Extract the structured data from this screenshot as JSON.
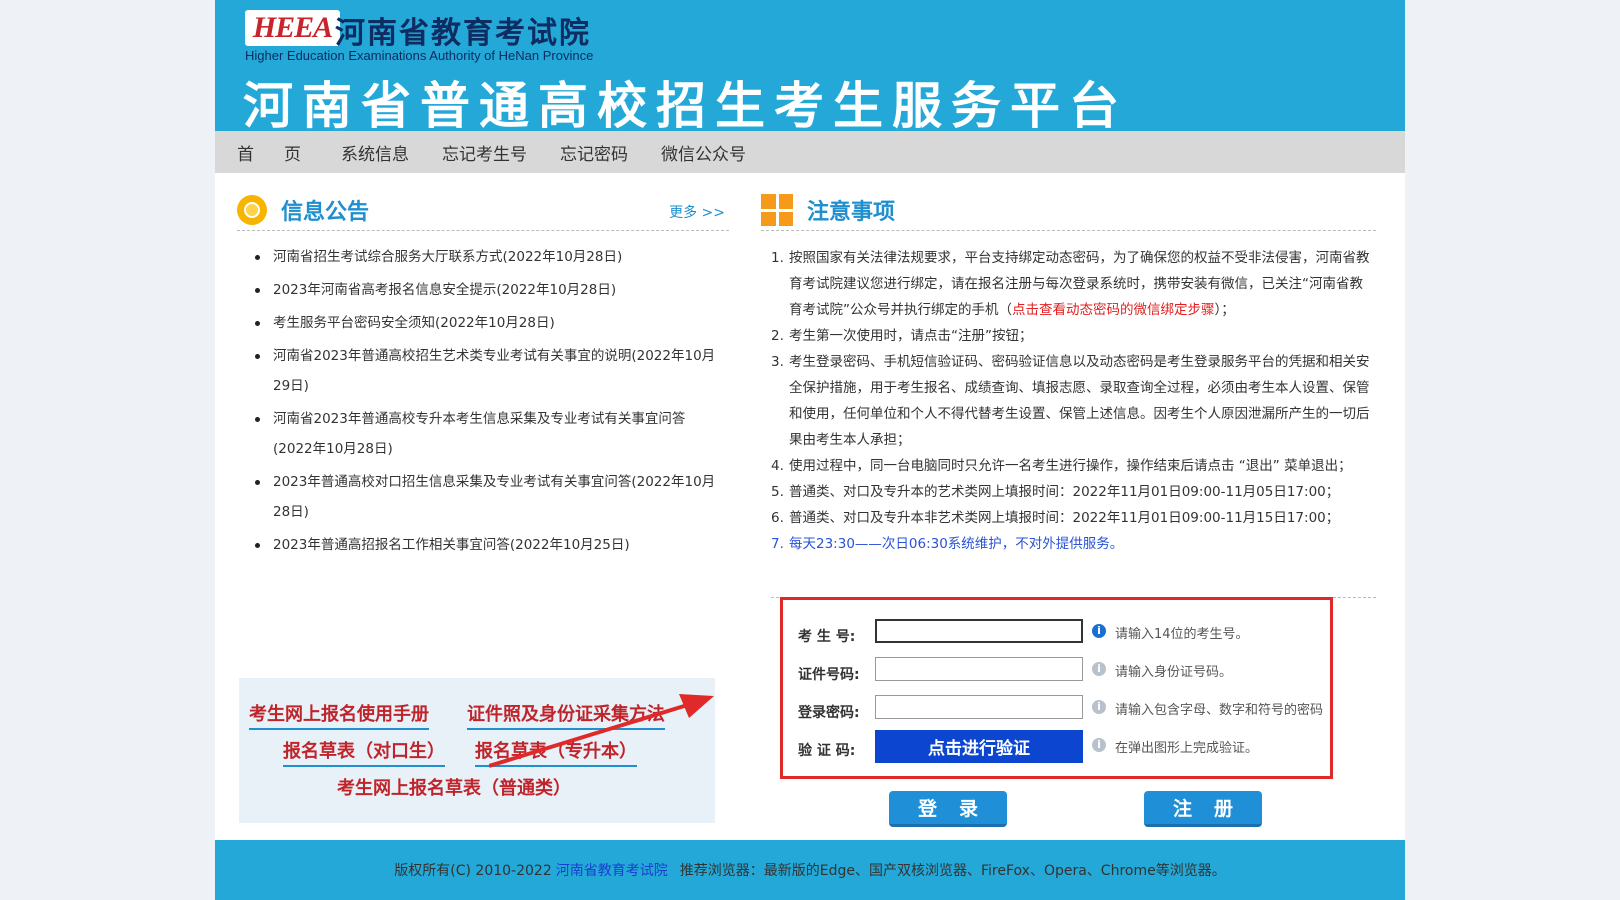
{
  "header": {
    "logo_text": "HEEA",
    "org_cn": "河南省教育考试院",
    "org_en": "Higher Education Examinations Authority of HeNan Province",
    "platform_title": "河南省普通高校招生考生服务平台"
  },
  "nav": {
    "home": "首页",
    "items": [
      "系统信息",
      "忘记考生号",
      "忘记密码",
      "微信公众号"
    ]
  },
  "announcements": {
    "title": "信息公告",
    "more": "更多 >>",
    "items": [
      "河南省招生考试综合服务大厅联系方式(2022年10月28日)",
      "2023年河南省高考报名信息安全提示(2022年10月28日)",
      "考生服务平台密码安全须知(2022年10月28日)",
      "河南省2023年普通高校招生艺术类专业考试有关事宜的说明(2022年10月29日)",
      "河南省2023年普通高校专升本考生信息采集及专业考试有关事宜问答(2022年10月28日)",
      "2023年普通高校对口招生信息采集及专业考试有关事宜问答(2022年10月28日)",
      "2023年普通高招报名工作相关事宜问答(2022年10月25日)"
    ]
  },
  "downloads": {
    "manual": "考生网上报名使用手册",
    "photo": "证件照及身份证采集方法",
    "form_duikou": "报名草表（对口生）",
    "form_zhuanshengben": "报名草表（专升本）",
    "form_putong": "考生网上报名草表（普通类）"
  },
  "notice": {
    "title": "注意事项",
    "n1_num": "1.",
    "n1_text": "按照国家有关法律法规要求，平台支持绑定动态密码，为了确保您的权益不受非法侵害，河南省教育考试院建议您进行绑定，请在报名注册与每次登录系统时，携带安装有微信，已关注“河南省教育考试院”公众号并执行绑定的手机（",
    "n1_link": "点击查看动态密码的微信绑定步骤",
    "n1_tail": "）；",
    "n2_num": "2.",
    "n2_text": "考生第一次使用时，请点击“注册”按钮；",
    "n3_num": "3.",
    "n3_text": "考生登录密码、手机短信验证码、密码验证信息以及动态密码是考生登录服务平台的凭据和相关安全保护措施，用于考生报名、成绩查询、填报志愿、录取查询全过程，必须由考生本人设置、保管和使用，任何单位和个人不得代替考生设置、保管上述信息。因考生个人原因泄漏所产生的一切后果由考生本人承担；",
    "n4_num": "4.",
    "n4_text": "使用过程中，同一台电脑同时只允许一名考生进行操作，操作结束后请点击 “退出” 菜单退出；",
    "n5_num": "5.",
    "n5_text": "普通类、对口及专升本的艺术类网上填报时间：2022年11月01日09:00-11月05日17:00；",
    "n6_num": "6.",
    "n6_text": "普通类、对口及专升本非艺术类网上填报时间：2022年11月01日09:00-11月15日17:00；",
    "n7_num": "7.",
    "n7_text": "每天23:30——次日06:30系统维护，不对外提供服务。"
  },
  "login": {
    "id_label": "考 生 号:",
    "id_value": "",
    "id_hint": "请输入14位的考生号。",
    "cert_label": "证件号码:",
    "cert_value": "",
    "cert_hint": "请输入身份证号码。",
    "pwd_label": "登录密码:",
    "pwd_value": "",
    "pwd_hint": "请输入包含字母、数字和符号的密码",
    "code_label": "验 证 码:",
    "verify_button": "点击进行验证",
    "code_hint": "在弹出图形上完成验证。",
    "login_button": "登录",
    "register_button": "注册"
  },
  "footer": {
    "copyright": "版权所有(C) 2010-2022",
    "org_link": "河南省教育考试院",
    "browsers": "推荐浏览器：最新版的Edge、国产双核浏览器、FireFox、Opera、Chrome等浏览器。"
  },
  "colors": {
    "brand_blue": "#23a8d8",
    "accent_red": "#e02a2a",
    "verify_blue": "#0c46d0"
  }
}
